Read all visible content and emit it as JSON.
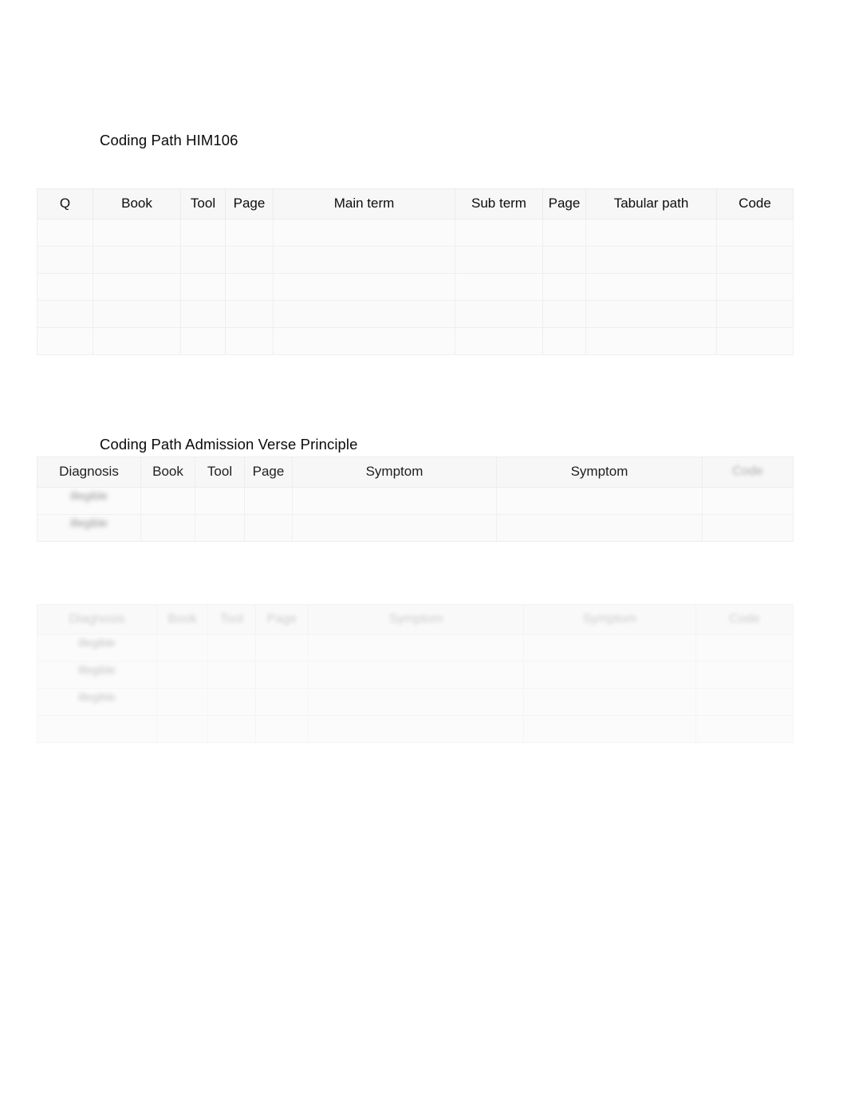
{
  "document": {
    "background_color": "#ffffff",
    "text_color": "#000000",
    "grid_color": "#ececec"
  },
  "headings": {
    "first": "Coding Path HIM106",
    "second": "Coding Path Admission Verse Principle"
  },
  "table1": {
    "name": "coding-path-him106-table",
    "columns": [
      "Q",
      "Book",
      "Tool",
      "Page",
      "Main term",
      "Sub term",
      "Page",
      "Tabular path",
      "Code"
    ],
    "rows": [
      [
        "",
        "",
        "",
        "",
        "",
        "",
        "",
        "",
        ""
      ],
      [
        "",
        "",
        "",
        "",
        "",
        "",
        "",
        "",
        ""
      ],
      [
        "",
        "",
        "",
        "",
        "",
        "",
        "",
        "",
        ""
      ],
      [
        "",
        "",
        "",
        "",
        "",
        "",
        "",
        "",
        ""
      ],
      [
        "",
        "",
        "",
        "",
        "",
        "",
        "",
        "",
        ""
      ]
    ]
  },
  "table2": {
    "name": "coding-path-admission-verse-principle-table",
    "columns": [
      "Diagnosis",
      "Book",
      "Tool",
      "Page",
      "Symptom",
      "Symptom",
      "Code"
    ],
    "columns_legible": [
      true,
      true,
      true,
      true,
      true,
      true,
      false
    ],
    "rows": [
      [
        "illegible",
        "",
        "",
        "",
        "",
        "",
        ""
      ],
      [
        "illegible",
        "",
        "",
        "",
        "",
        "",
        ""
      ]
    ]
  },
  "table3": {
    "name": "coding-path-third-table",
    "columns": [
      "Diagnosis",
      "Book",
      "Tool",
      "Page",
      "Symptom",
      "Symptom",
      "Code"
    ],
    "columns_legible": [
      false,
      false,
      false,
      false,
      false,
      false,
      false
    ],
    "rows": [
      [
        "illegible",
        "",
        "",
        "",
        "",
        "",
        ""
      ],
      [
        "illegible",
        "",
        "",
        "",
        "",
        "",
        ""
      ],
      [
        "illegible",
        "",
        "",
        "",
        "",
        "",
        ""
      ],
      [
        "",
        "",
        "",
        "",
        "",
        "",
        ""
      ]
    ]
  }
}
